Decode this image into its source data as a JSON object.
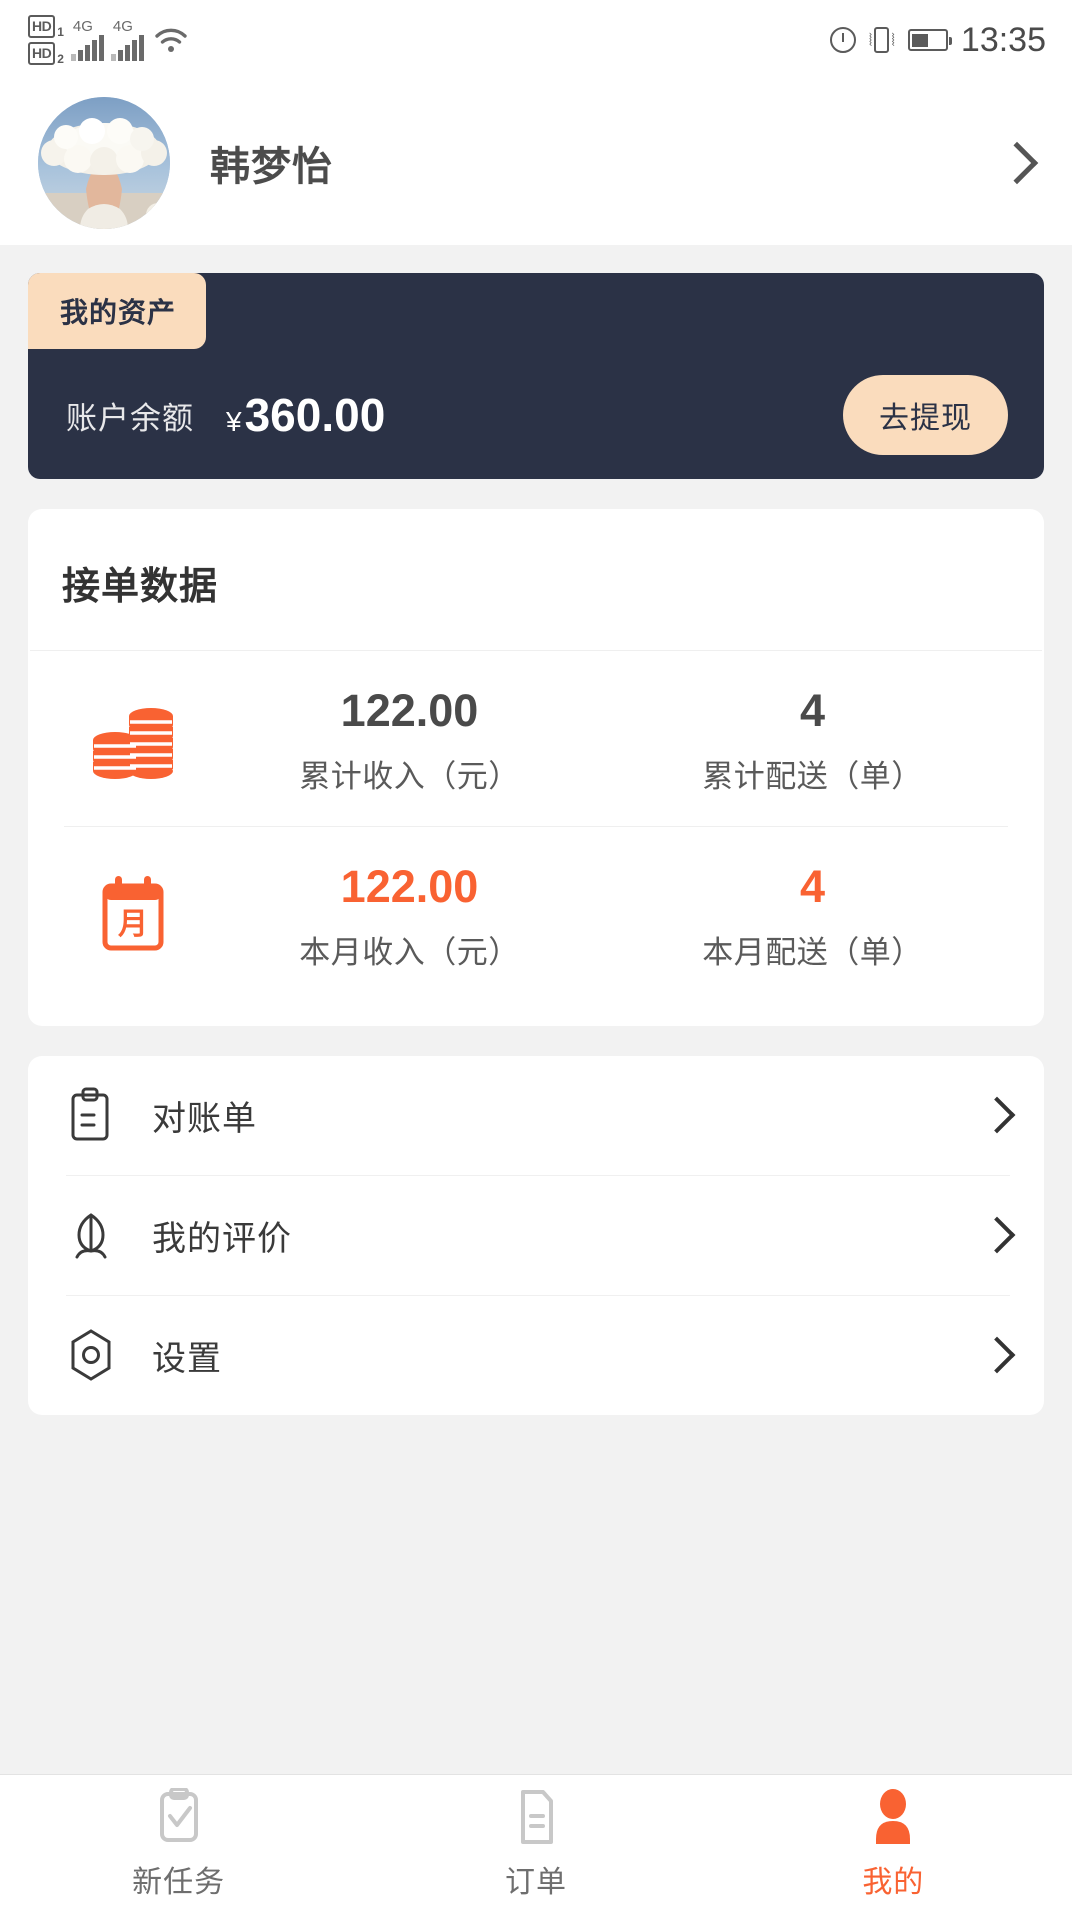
{
  "status_bar": {
    "hd1_label": "HD",
    "hd1_sim": "1",
    "hd2_label": "HD",
    "hd2_sim": "2",
    "network_1": "4G",
    "network_2": "4G",
    "wifi_icon": "wifi-icon",
    "alarm_icon": "alarm-clock-icon",
    "vibrate_icon": "vibrate-icon",
    "battery_icon": "battery-half-icon",
    "time": "13:35"
  },
  "profile": {
    "avatar_icon": "user-avatar",
    "name": "韩梦怡",
    "chevron_icon": "chevron-right-icon"
  },
  "asset_card": {
    "tab_label": "我的资产",
    "balance_label": "账户余额",
    "currency_symbol": "¥",
    "balance_value": "360.00",
    "withdraw_label": "去提现",
    "bg_color": "#2b3246",
    "accent_color": "#fadcbd"
  },
  "stats": {
    "title": "接单数据",
    "rows": [
      {
        "icon": "coin-stack-icon",
        "accent": false,
        "cells": [
          {
            "value": "122.00",
            "caption": "累计收入（元）"
          },
          {
            "value": "4",
            "caption": "累计配送（单）"
          }
        ]
      },
      {
        "icon": "calendar-month-icon",
        "accent": true,
        "cells": [
          {
            "value": "122.00",
            "caption": "本月收入（元）"
          },
          {
            "value": "4",
            "caption": "本月配送（单）"
          }
        ]
      }
    ],
    "accent_color": "#f96232"
  },
  "menu": {
    "items": [
      {
        "icon": "clipboard-icon",
        "label": "对账单",
        "chevron": "chevron-right-icon"
      },
      {
        "icon": "flower-icon",
        "label": "我的评价",
        "chevron": "chevron-right-icon"
      },
      {
        "icon": "settings-hex-icon",
        "label": "设置",
        "chevron": "chevron-right-icon"
      }
    ]
  },
  "tabbar": {
    "active_color": "#f96232",
    "inactive_color": "#c8c8c8",
    "tabs": [
      {
        "icon": "task-checklist-icon",
        "label": "新任务",
        "active": false
      },
      {
        "icon": "order-document-icon",
        "label": "订单",
        "active": false
      },
      {
        "icon": "person-icon",
        "label": "我的",
        "active": true
      }
    ]
  }
}
